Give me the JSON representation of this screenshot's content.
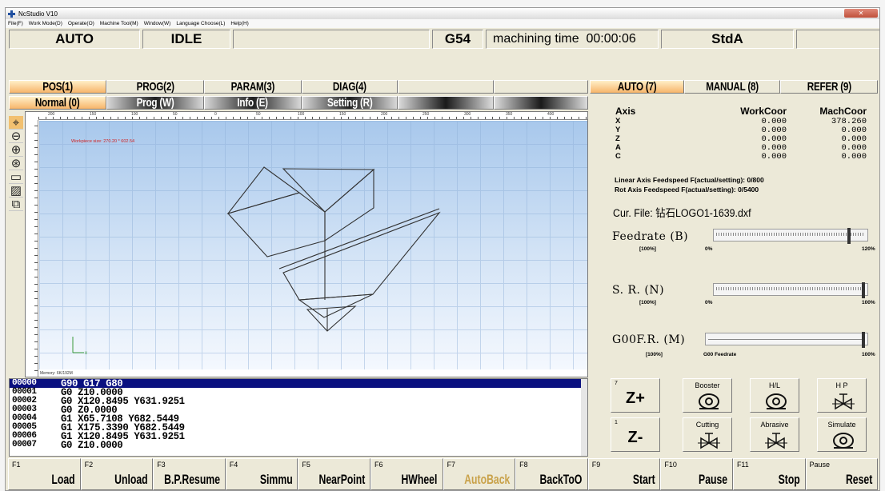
{
  "window": {
    "title": "NcStudio V10",
    "menu": [
      "File(F)",
      "Work Mode(D)",
      "Operate(O)",
      "Machine Tool(M)",
      "Window(W)",
      "Language Choose(L)",
      "Help(H)"
    ]
  },
  "status": {
    "mode": "AUTO",
    "state": "IDLE",
    "coord_sys": "G54",
    "machining_time_label": "machining time",
    "machining_time": "00:00:06",
    "std": "StdA"
  },
  "tabs_left": [
    {
      "label": "POS(1)",
      "active": true
    },
    {
      "label": "PROG(2)",
      "active": false
    },
    {
      "label": "PARAM(3)",
      "active": false
    },
    {
      "label": "DIAG(4)",
      "active": false
    }
  ],
  "subtabs_left": [
    {
      "label": "Normal (0)"
    },
    {
      "label": "Prog (W)"
    },
    {
      "label": "Info (E)"
    },
    {
      "label": "Setting (R)"
    }
  ],
  "tabs_right": [
    {
      "label": "AUTO (7)",
      "active": true
    },
    {
      "label": "MANUAL (8)",
      "active": false
    },
    {
      "label": "REFER (9)",
      "active": false
    }
  ],
  "toolbar_icons": [
    "crosshair-icon",
    "zoom-out-icon",
    "zoom-in-icon",
    "fit-view-icon",
    "rectangle-icon",
    "clear-icon",
    "3d-view-icon"
  ],
  "viewport": {
    "workpiece_label": "Workpiece size: 270.20 * 602.54",
    "memory_label": "Memory: 6K/192M",
    "ruler_numbers": [
      "200",
      "150",
      "100",
      "50",
      "0",
      "50",
      "100",
      "150",
      "200",
      "250",
      "300",
      "350",
      "400"
    ]
  },
  "code": [
    {
      "ln": "00000",
      "text": "G90 G17 G80"
    },
    {
      "ln": "00001",
      "text": "G0 Z10.0000"
    },
    {
      "ln": "00002",
      "text": "G0 X120.8495 Y631.9251"
    },
    {
      "ln": "00003",
      "text": "G0 Z0.0000"
    },
    {
      "ln": "00004",
      "text": "G1 X65.7108 Y682.5449"
    },
    {
      "ln": "00005",
      "text": "G1 X175.3390 Y682.5449"
    },
    {
      "ln": "00006",
      "text": "G1 X120.8495 Y631.9251"
    },
    {
      "ln": "00007",
      "text": "G0 Z10.0000"
    }
  ],
  "axis": {
    "headers": [
      "Axis",
      "WorkCoor",
      "MachCoor"
    ],
    "rows": [
      {
        "name": "X",
        "work": "0.000",
        "mach": "378.260"
      },
      {
        "name": "Y",
        "work": "0.000",
        "mach": "0.000"
      },
      {
        "name": "Z",
        "work": "0.000",
        "mach": "0.000"
      },
      {
        "name": "A",
        "work": "0.000",
        "mach": "0.000"
      },
      {
        "name": "C",
        "work": "0.000",
        "mach": "0.000"
      }
    ]
  },
  "feed": {
    "linear": "Linear Axis Feedspeed F(actual/setting): 0/800",
    "rot": "Rot Axis Feedspeed F(actual/setting):  0/5400"
  },
  "cur_file": "Cur. File: 钻石LOGO1-1639.dxf",
  "sliders": [
    {
      "label": "Feedrate (B)",
      "left": "[100%]",
      "mid": "0%",
      "right": "120%",
      "level": 0.9
    },
    {
      "label": "S. R. (N)",
      "left": "[100%]",
      "mid": "0%",
      "right": "100%",
      "level": 1.0
    },
    {
      "label": "G00F.R. (M)",
      "left": "[100%]",
      "mid": "G00 Feedrate",
      "right": "100%",
      "level": 1.0
    }
  ],
  "controls": {
    "zplus": {
      "num": "7",
      "label": "Z+"
    },
    "zminus": {
      "num": "1",
      "label": "Z-"
    },
    "booster": "Booster",
    "hl": "H/L",
    "hp": "H P",
    "cutting": "Cutting",
    "abrasive": "Abrasive",
    "simulate": "Simulate"
  },
  "fkeys": [
    {
      "code": "F1",
      "name": "Load"
    },
    {
      "code": "F2",
      "name": "Unload"
    },
    {
      "code": "F3",
      "name": "B.P.Resume"
    },
    {
      "code": "F4",
      "name": "Simmu"
    },
    {
      "code": "F5",
      "name": "NearPoint"
    },
    {
      "code": "F6",
      "name": "HWheel"
    },
    {
      "code": "F7",
      "name": "AutoBack"
    },
    {
      "code": "F8",
      "name": "BackToO"
    },
    {
      "code": "F9",
      "name": "Start"
    },
    {
      "code": "F10",
      "name": "Pause"
    },
    {
      "code": "F11",
      "name": "Stop"
    },
    {
      "code": "Pause",
      "name": "Reset"
    }
  ],
  "colors": {
    "active_tab": "#f7b56a",
    "code_highlight": "#0a1080",
    "disabled_key": "#c9a24a"
  }
}
